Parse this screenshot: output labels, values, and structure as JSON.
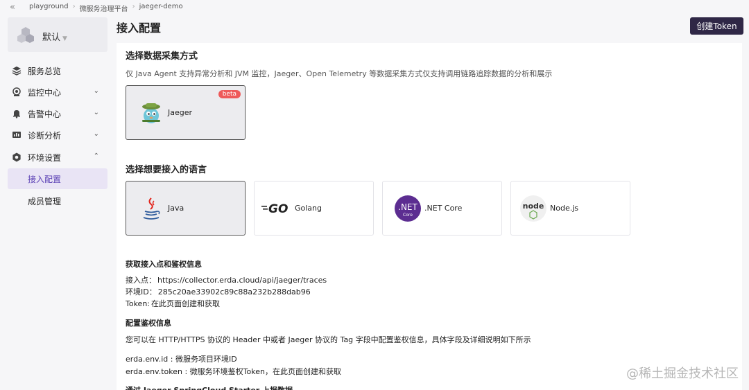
{
  "breadcrumb": [
    "playground",
    "微服务治理平台",
    "jaeger-demo"
  ],
  "workspace": {
    "name": "默认"
  },
  "sidebar": {
    "items": [
      {
        "label": "服务总览",
        "icon": "layers-icon"
      },
      {
        "label": "监控中心",
        "icon": "monitor-icon"
      },
      {
        "label": "告警中心",
        "icon": "bell-icon"
      },
      {
        "label": "诊断分析",
        "icon": "chart-icon"
      },
      {
        "label": "环境设置",
        "icon": "gear-icon"
      }
    ],
    "sub_items": [
      {
        "label": "接入配置",
        "active": true
      },
      {
        "label": "成员管理",
        "active": false
      }
    ]
  },
  "page": {
    "title": "接入配置",
    "create_token_label": "创建Token"
  },
  "collect": {
    "title": "选择数据采集方式",
    "description": "仅 Java Agent 支持异常分析和 JVM 监控，Jaeger、Open Telemetry 等数据采集方式仅支持调用链路追踪数据的分析和展示",
    "option": {
      "name": "Jaeger",
      "badge": "beta"
    }
  },
  "language": {
    "title": "选择想要接入的语言",
    "options": [
      {
        "name": "Java",
        "selected": true
      },
      {
        "name": "Golang",
        "selected": false,
        "logo_text": "GO"
      },
      {
        "name": ".NET Core",
        "selected": false,
        "logo_text": ".NET",
        "logo_sub": "Core"
      },
      {
        "name": "Node.js",
        "selected": false,
        "logo_text": "node"
      }
    ]
  },
  "endpoint": {
    "title": "获取接入点和鉴权信息",
    "lines": [
      {
        "key": "接入点：",
        "value": "https://collector.erda.cloud/api/jaeger/traces"
      },
      {
        "key": "环境ID：",
        "value": "285c20ae33902c89c88a232b288dab96"
      },
      {
        "key": "Token:",
        "value": "在此页面创建和获取"
      }
    ]
  },
  "auth": {
    "title": "配置鉴权信息",
    "description": "您可以在 HTTP/HTTPS 协议的 Header 中或者 Jaeger 协议的 Tag 字段中配置鉴权信息，具体字段及详细说明如下所示",
    "lines": [
      "erda.env.id : 微服务项目环境ID",
      "erda.env.token : 微服务环境鉴权Token，在此页面创建和获取"
    ]
  },
  "next_section_title": "通过 Jaeger SpringCloud Starter 上报数据",
  "watermark": "@稀土掘金技术社区",
  "colors": {
    "accent": "#5a3fb4",
    "button": "#2f2746",
    "beta": "#ee5a5a"
  }
}
